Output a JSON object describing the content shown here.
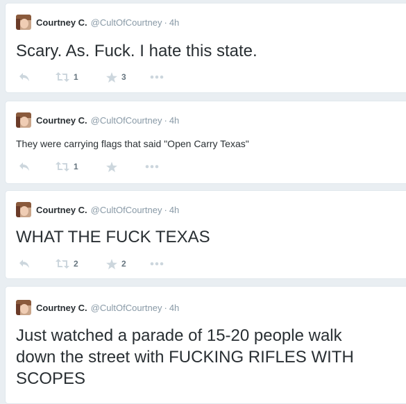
{
  "colors": {
    "background": "#e9eef2",
    "card": "#ffffff",
    "name": "#292f33",
    "meta": "#8899a6",
    "action_icon": "#ccd6dd",
    "action_count": "#66757f"
  },
  "icons": {
    "reply": "reply-icon",
    "retweet": "retweet-icon",
    "favorite": "star-icon",
    "more": "more-icon"
  },
  "tweets": [
    {
      "name": "Courtney C.",
      "handle": "@CultOfCourtney",
      "separator": "·",
      "time": "4h",
      "text": "Scary. As. Fuck. I hate this state.",
      "retweets": "1",
      "favorites": "3"
    },
    {
      "name": "Courtney C.",
      "handle": "@CultOfCourtney",
      "separator": "·",
      "time": "4h",
      "text": "They were carrying flags that said \"Open Carry Texas\"",
      "retweets": "1",
      "favorites": ""
    },
    {
      "name": "Courtney C.",
      "handle": "@CultOfCourtney",
      "separator": "·",
      "time": "4h",
      "text": "WHAT THE FUCK TEXAS",
      "retweets": "2",
      "favorites": "2"
    },
    {
      "name": "Courtney C.",
      "handle": "@CultOfCourtney",
      "separator": "·",
      "time": "4h",
      "text": "Just watched a parade of 15-20 people walk down the street with FUCKING RIFLES WITH SCOPES",
      "retweets": "",
      "favorites": ""
    }
  ]
}
